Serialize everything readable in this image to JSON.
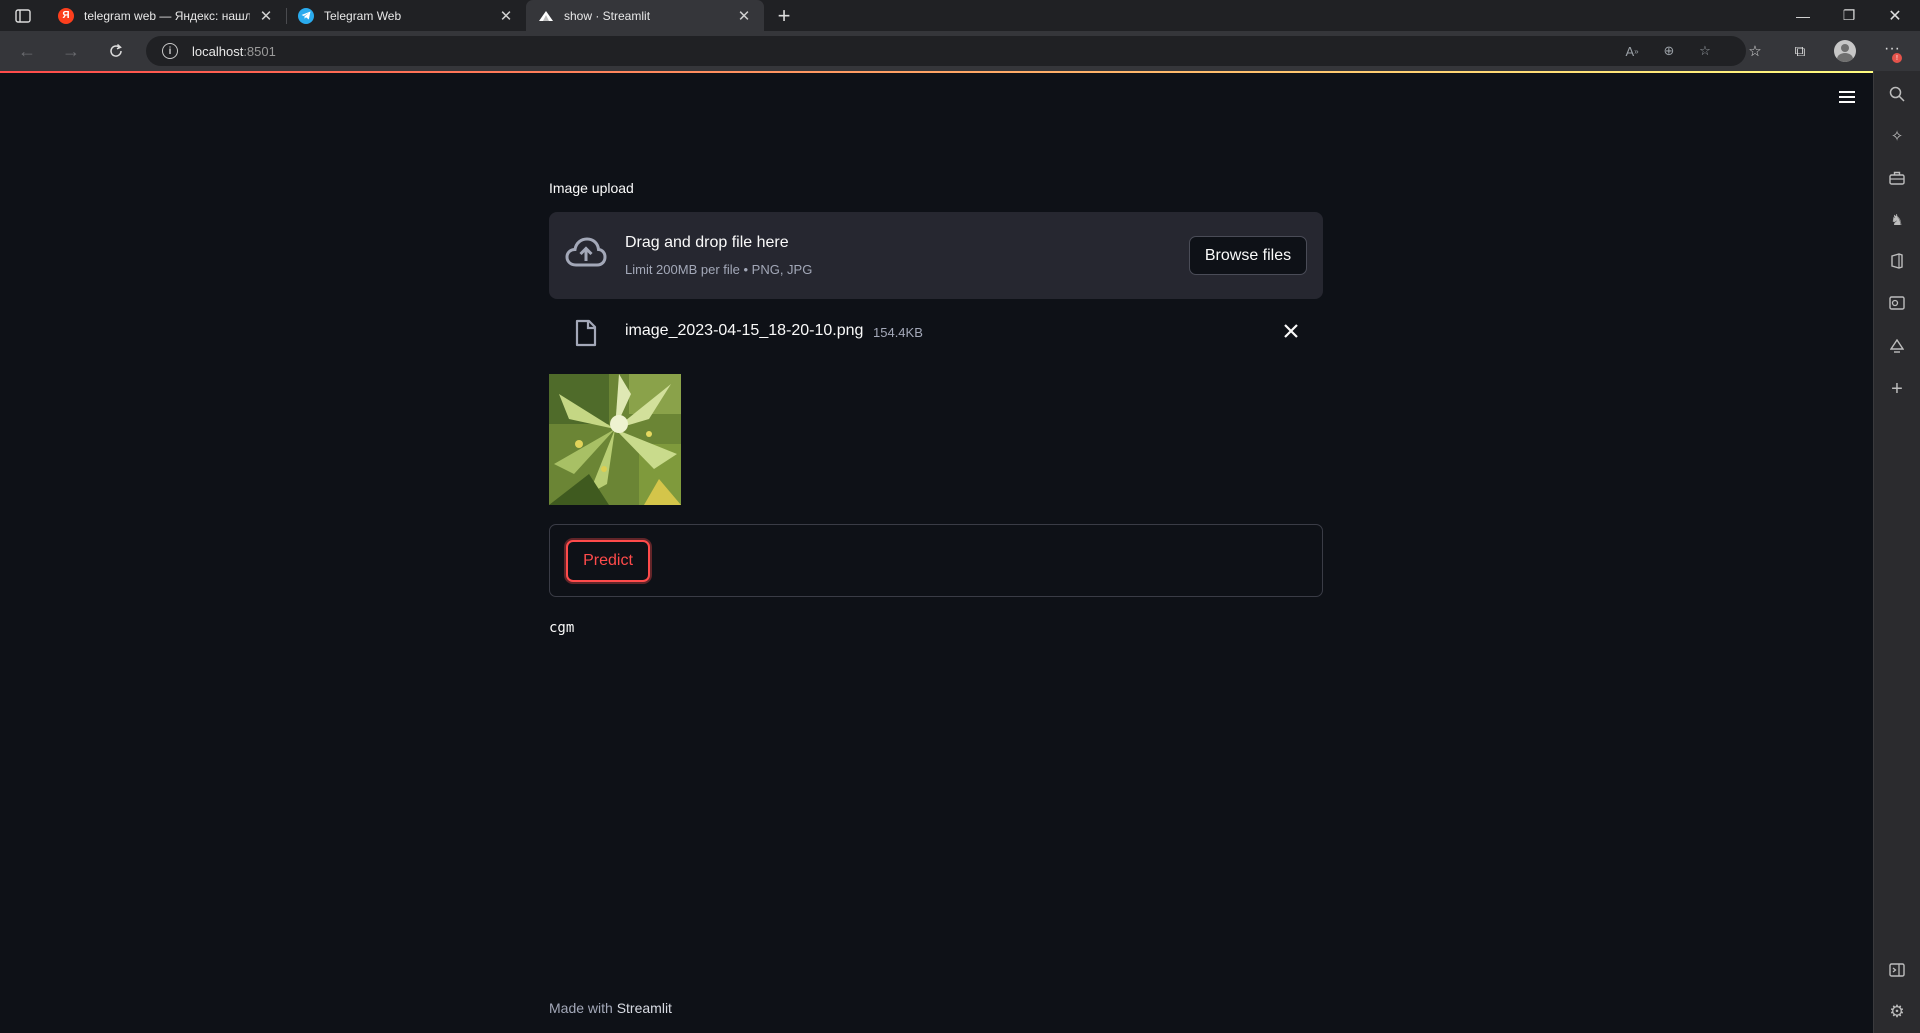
{
  "browser": {
    "tabs": [
      {
        "title": "telegram web — Яндекс: нашлось",
        "favicon_letter": "Я"
      },
      {
        "title": "Telegram Web",
        "favicon_letter": ""
      },
      {
        "title": "show · Streamlit",
        "favicon_letter": ""
      }
    ],
    "new_tab_symbol": "+",
    "address": {
      "host": "localhost",
      "port": ":8501"
    },
    "window_controls": [
      "minimize",
      "restore",
      "close"
    ]
  },
  "app": {
    "uploader_label": "Image upload",
    "dropzone_title": "Drag and drop file here",
    "dropzone_subtitle": "Limit 200MB per file • PNG, JPG",
    "browse_button": "Browse files",
    "file": {
      "name": "image_2023-04-15_18-20-10.png",
      "size": "154.4KB"
    },
    "predict_button": "Predict",
    "output": "cgm",
    "footer_prefix": "Made with ",
    "footer_brand": "Streamlit"
  },
  "colors": {
    "background": "#0e1117",
    "accent": "#ff4b4b",
    "dropzone_bg": "#262730",
    "text": "#fafafa"
  },
  "icons": {
    "sidebar": [
      "search-icon",
      "copilot-icon",
      "tools-icon",
      "games-icon",
      "office-icon",
      "outlook-icon",
      "drop-icon",
      "add-icon",
      "sidebar-toggle-icon",
      "settings-icon"
    ]
  }
}
